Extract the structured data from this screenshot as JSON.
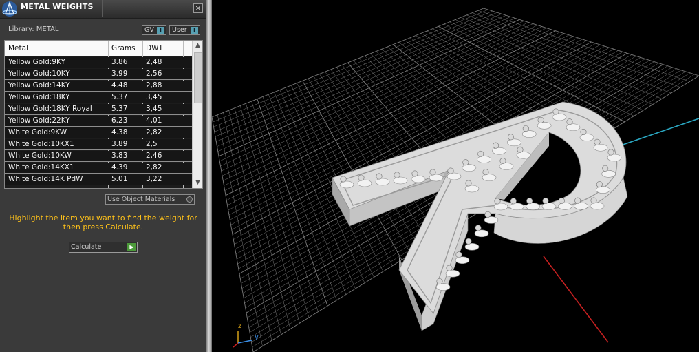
{
  "panel": {
    "title": "METAL WEIGHTS",
    "close_glyph": "×",
    "logo_icon": "app-logo-icon",
    "library_label": "Library: METAL",
    "library_buttons": [
      {
        "label": "GV",
        "indicator": "I"
      },
      {
        "label": "User",
        "indicator": "I"
      }
    ]
  },
  "table": {
    "headers": [
      "Metal",
      "Grams",
      "DWT"
    ],
    "rows": [
      {
        "metal": "Yellow Gold:9KY",
        "grams": "3.86",
        "dwt": "2,48"
      },
      {
        "metal": "Yellow Gold:10KY",
        "grams": "3.99",
        "dwt": "2,56"
      },
      {
        "metal": "Yellow Gold:14KY",
        "grams": "4.48",
        "dwt": "2,88"
      },
      {
        "metal": "Yellow Gold:18KY",
        "grams": "5.37",
        "dwt": "3,45"
      },
      {
        "metal": "Yellow Gold:18KY Royal",
        "grams": "5.37",
        "dwt": "3,45"
      },
      {
        "metal": "Yellow Gold:22KY",
        "grams": "6.23",
        "dwt": "4,01"
      },
      {
        "metal": "White Gold:9KW",
        "grams": "4.38",
        "dwt": "2,82"
      },
      {
        "metal": "White Gold:10KX1",
        "grams": "3.89",
        "dwt": "2,5"
      },
      {
        "metal": "White Gold:10KW",
        "grams": "3.83",
        "dwt": "2,46"
      },
      {
        "metal": "White Gold:14KX1",
        "grams": "4.39",
        "dwt": "2,82"
      },
      {
        "metal": "White Gold:14K PdW",
        "grams": "5.01",
        "dwt": "3,22"
      }
    ],
    "scroll_up_glyph": "▲",
    "scroll_down_glyph": "▼"
  },
  "controls": {
    "use_object_materials": "Use Object Materials",
    "hint": "Highlight the item you want to find the weight for then press Calculate.",
    "calculate": "Calculate",
    "calculate_glyph": "▶"
  },
  "viewport": {
    "axis_z": "z",
    "axis_y": "y",
    "colors": {
      "grid": "#7a7a7a",
      "axis_x": "#c62020",
      "axis_y": "#2aa6c0",
      "model": "#c9c9c9",
      "hint_text": "#ffc21a"
    }
  }
}
